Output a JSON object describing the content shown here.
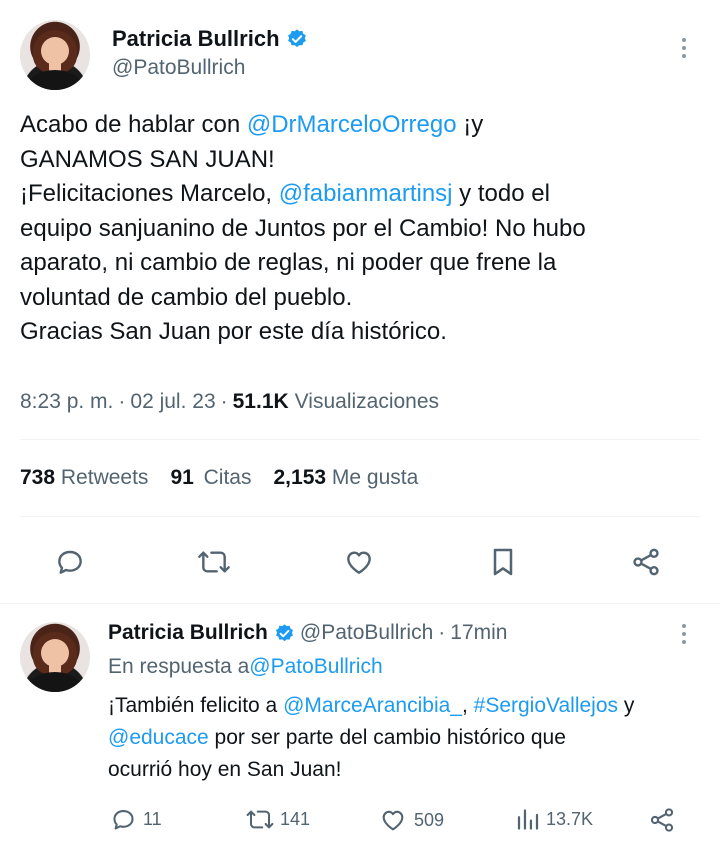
{
  "main_tweet": {
    "author_name": "Patricia Bullrich",
    "handle": "@PatoBullrich",
    "body": {
      "l1a": "Acabo de hablar con ",
      "l1m": "@DrMarceloOrrego",
      "l1b": " ¡y",
      "l2": "GANAMOS SAN JUAN!",
      "l3a": "¡Felicitaciones Marcelo, ",
      "l3m": "@fabianmartinsj",
      "l3b": " y todo el",
      "l4": "equipo sanjuanino de Juntos por el Cambio! No hubo",
      "l5": "aparato, ni cambio de reglas, ni poder que frene la",
      "l6": "voluntad de cambio del pueblo.",
      "l7": "Gracias San Juan por este día histórico."
    },
    "time": "8:23 p. m.",
    "sep": "·",
    "date": "02 jul. 23",
    "views_count": "51.1K",
    "views_label": "Visualizaciones",
    "stats": {
      "retweets_count": "738",
      "retweets_label": "Retweets",
      "quotes_count": "91",
      "quotes_label": "Citas",
      "likes_count": "2,153",
      "likes_label": "Me gusta"
    }
  },
  "reply_tweet": {
    "author_name": "Patricia Bullrich",
    "handle": "@PatoBullrich",
    "sep": "·",
    "time": "17min",
    "reply_prefix": "En respuesta a ",
    "reply_to": "@PatoBullrich",
    "body": {
      "l1a": "¡También felicito a ",
      "l1m1": "@MarceArancibia_",
      "l1c": ", ",
      "l1m2": "#SergioVallejos",
      "l1b": " y",
      "l2m": "@educace",
      "l2a": " por ser parte del cambio histórico que",
      "l3": "ocurrió hoy en San Juan!"
    },
    "actions": {
      "replies": "11",
      "retweets": "141",
      "likes": "509",
      "views": "13.7K"
    }
  },
  "icons": {
    "verified": "verified-badge-icon",
    "more": "more-options-icon",
    "reply": "reply-icon",
    "retweet": "retweet-icon",
    "like": "heart-icon",
    "bookmark": "bookmark-icon",
    "share": "share-icon",
    "views": "views-chart-icon"
  },
  "colors": {
    "link": "#1d9bf0",
    "text": "#0f1419",
    "muted": "#536471",
    "divider": "#eff3f4"
  }
}
